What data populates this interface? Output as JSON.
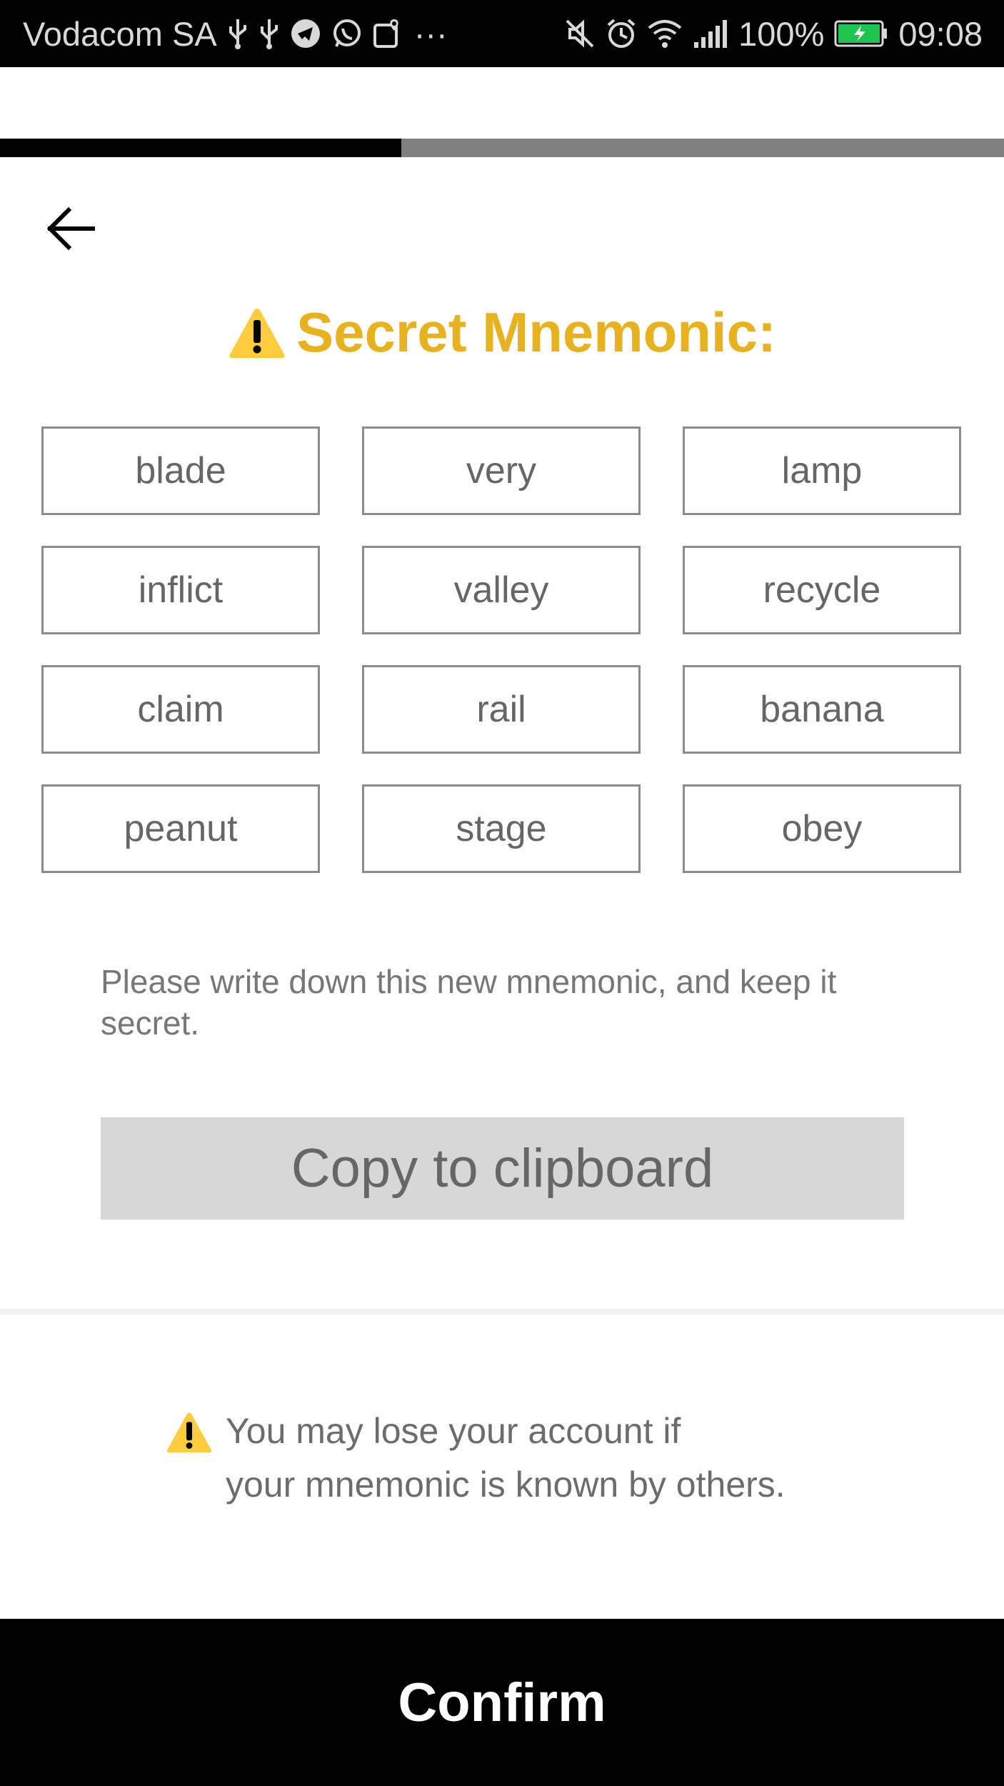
{
  "status_bar": {
    "carrier": "Vodacom SA",
    "more": "···",
    "battery_percent": "100%",
    "time": "09:08",
    "left_icons": [
      "usb-icon",
      "usb-icon",
      "telegram-icon",
      "whatsapp-icon",
      "maps-icon"
    ],
    "right_icons": [
      "mute-icon",
      "alarm-icon",
      "wifi-icon",
      "signal-icon",
      "battery-charging-icon"
    ]
  },
  "progress": {
    "value": 0.4
  },
  "header": {
    "back_icon": "arrow-left-icon"
  },
  "title": {
    "icon": "warning-icon",
    "text": "Secret Mnemonic:",
    "color": "#e8b21e"
  },
  "mnemonic": {
    "words": [
      "blade",
      "very",
      "lamp",
      "inflict",
      "valley",
      "recycle",
      "claim",
      "rail",
      "banana",
      "peanut",
      "stage",
      "obey"
    ]
  },
  "instructions": "Please write down this new mnemonic, and keep it secret.",
  "copy_button": {
    "label": "Copy to clipboard"
  },
  "warning": {
    "icon": "warning-icon",
    "line1": "You may lose your account if",
    "line2": "your mnemonic is known by others."
  },
  "confirm_button": {
    "label": "Confirm"
  }
}
